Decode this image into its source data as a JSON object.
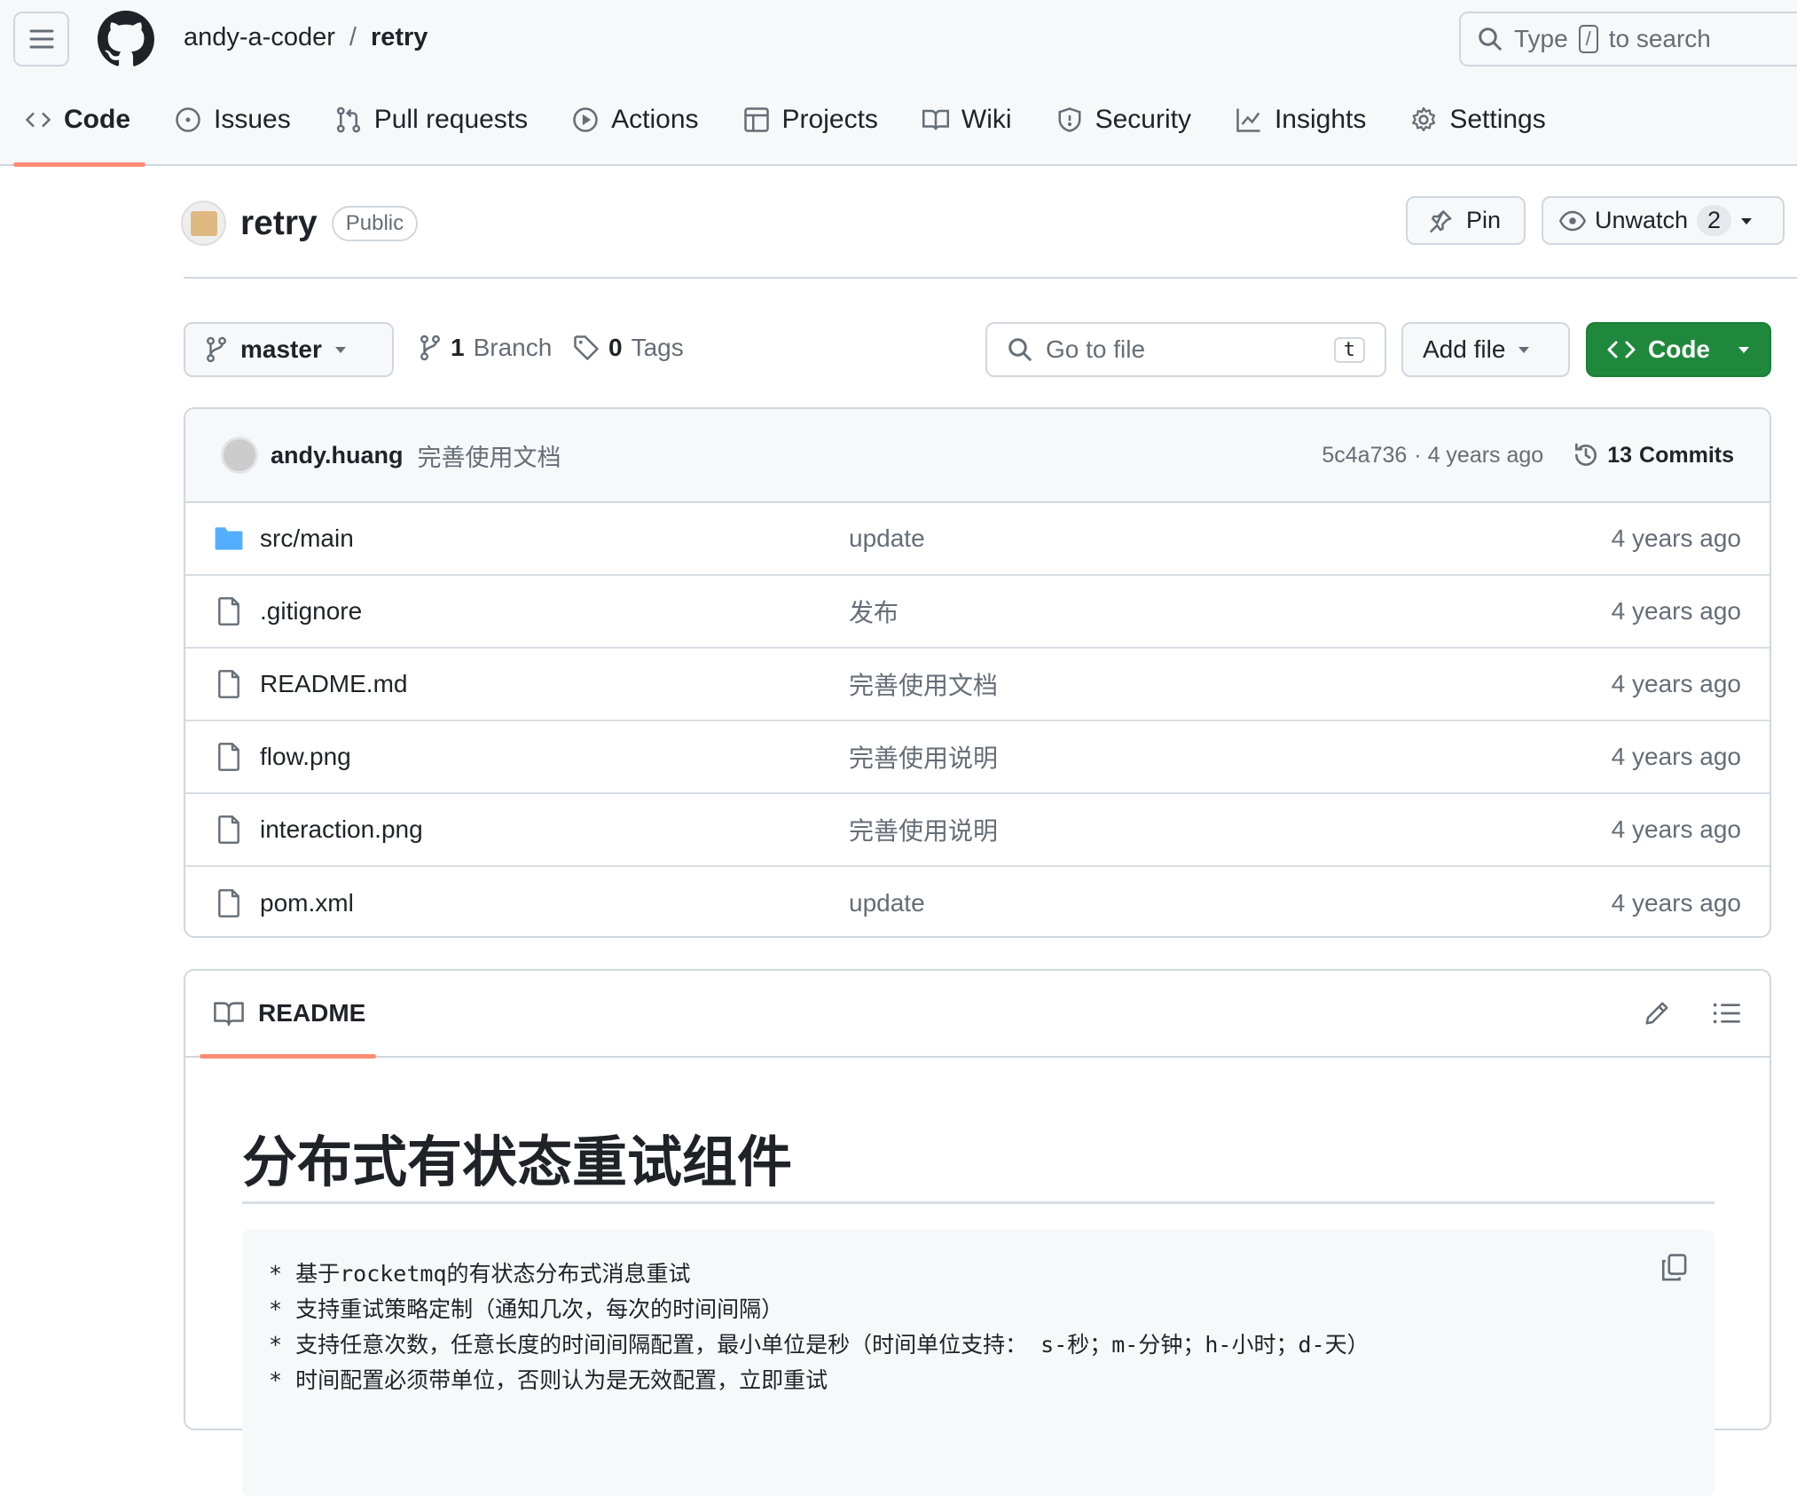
{
  "header": {
    "owner": "andy-a-coder",
    "separator": "/",
    "repo": "retry",
    "search_prefix": "Type",
    "search_key": "/",
    "search_suffix": "to search"
  },
  "tabs": [
    {
      "label": "Code",
      "icon": "code-icon"
    },
    {
      "label": "Issues",
      "icon": "issue-icon"
    },
    {
      "label": "Pull requests",
      "icon": "pull-request-icon"
    },
    {
      "label": "Actions",
      "icon": "play-icon"
    },
    {
      "label": "Projects",
      "icon": "table-icon"
    },
    {
      "label": "Wiki",
      "icon": "book-icon"
    },
    {
      "label": "Security",
      "icon": "shield-icon"
    },
    {
      "label": "Insights",
      "icon": "graph-icon"
    },
    {
      "label": "Settings",
      "icon": "gear-icon"
    }
  ],
  "repo": {
    "name": "retry",
    "visibility": "Public",
    "pin": "Pin",
    "unwatch": "Unwatch",
    "watch_count": "2"
  },
  "toolbar": {
    "branch": "master",
    "branches_count": "1",
    "branches_label": "Branch",
    "tags_count": "0",
    "tags_label": "Tags",
    "go_to_file": "Go to file",
    "go_to_file_key": "t",
    "add_file": "Add file",
    "code": "Code"
  },
  "commit": {
    "author": "andy.huang",
    "message": "完善使用文档",
    "sha": "5c4a736",
    "age": "· 4 years ago",
    "commits_count": "13",
    "commits_label": "Commits"
  },
  "files": [
    {
      "name": "src/main",
      "type": "folder",
      "message": "update",
      "age": "4 years ago"
    },
    {
      "name": ".gitignore",
      "type": "file",
      "message": "发布",
      "age": "4 years ago"
    },
    {
      "name": "README.md",
      "type": "file",
      "message": "完善使用文档",
      "age": "4 years ago"
    },
    {
      "name": "flow.png",
      "type": "file",
      "message": "完善使用说明",
      "age": "4 years ago"
    },
    {
      "name": "interaction.png",
      "type": "file",
      "message": "完善使用说明",
      "age": "4 years ago"
    },
    {
      "name": "pom.xml",
      "type": "file",
      "message": "update",
      "age": "4 years ago"
    }
  ],
  "readme": {
    "tab": "README",
    "title": "分布式有状态重试组件",
    "lines": [
      "* 基于rocketmq的有状态分布式消息重试",
      "* 支持重试策略定制（通知几次，每次的时间间隔）",
      "* 支持任意次数，任意长度的时间间隔配置，最小单位是秒（时间单位支持： s-秒；m-分钟；h-小时；d-天）",
      "* 时间配置必须带单位，否则认为是无效配置，立即重试"
    ]
  },
  "colors": {
    "accent": "#fd8c73",
    "green": "#1f883d",
    "folder": "#54aeff"
  }
}
